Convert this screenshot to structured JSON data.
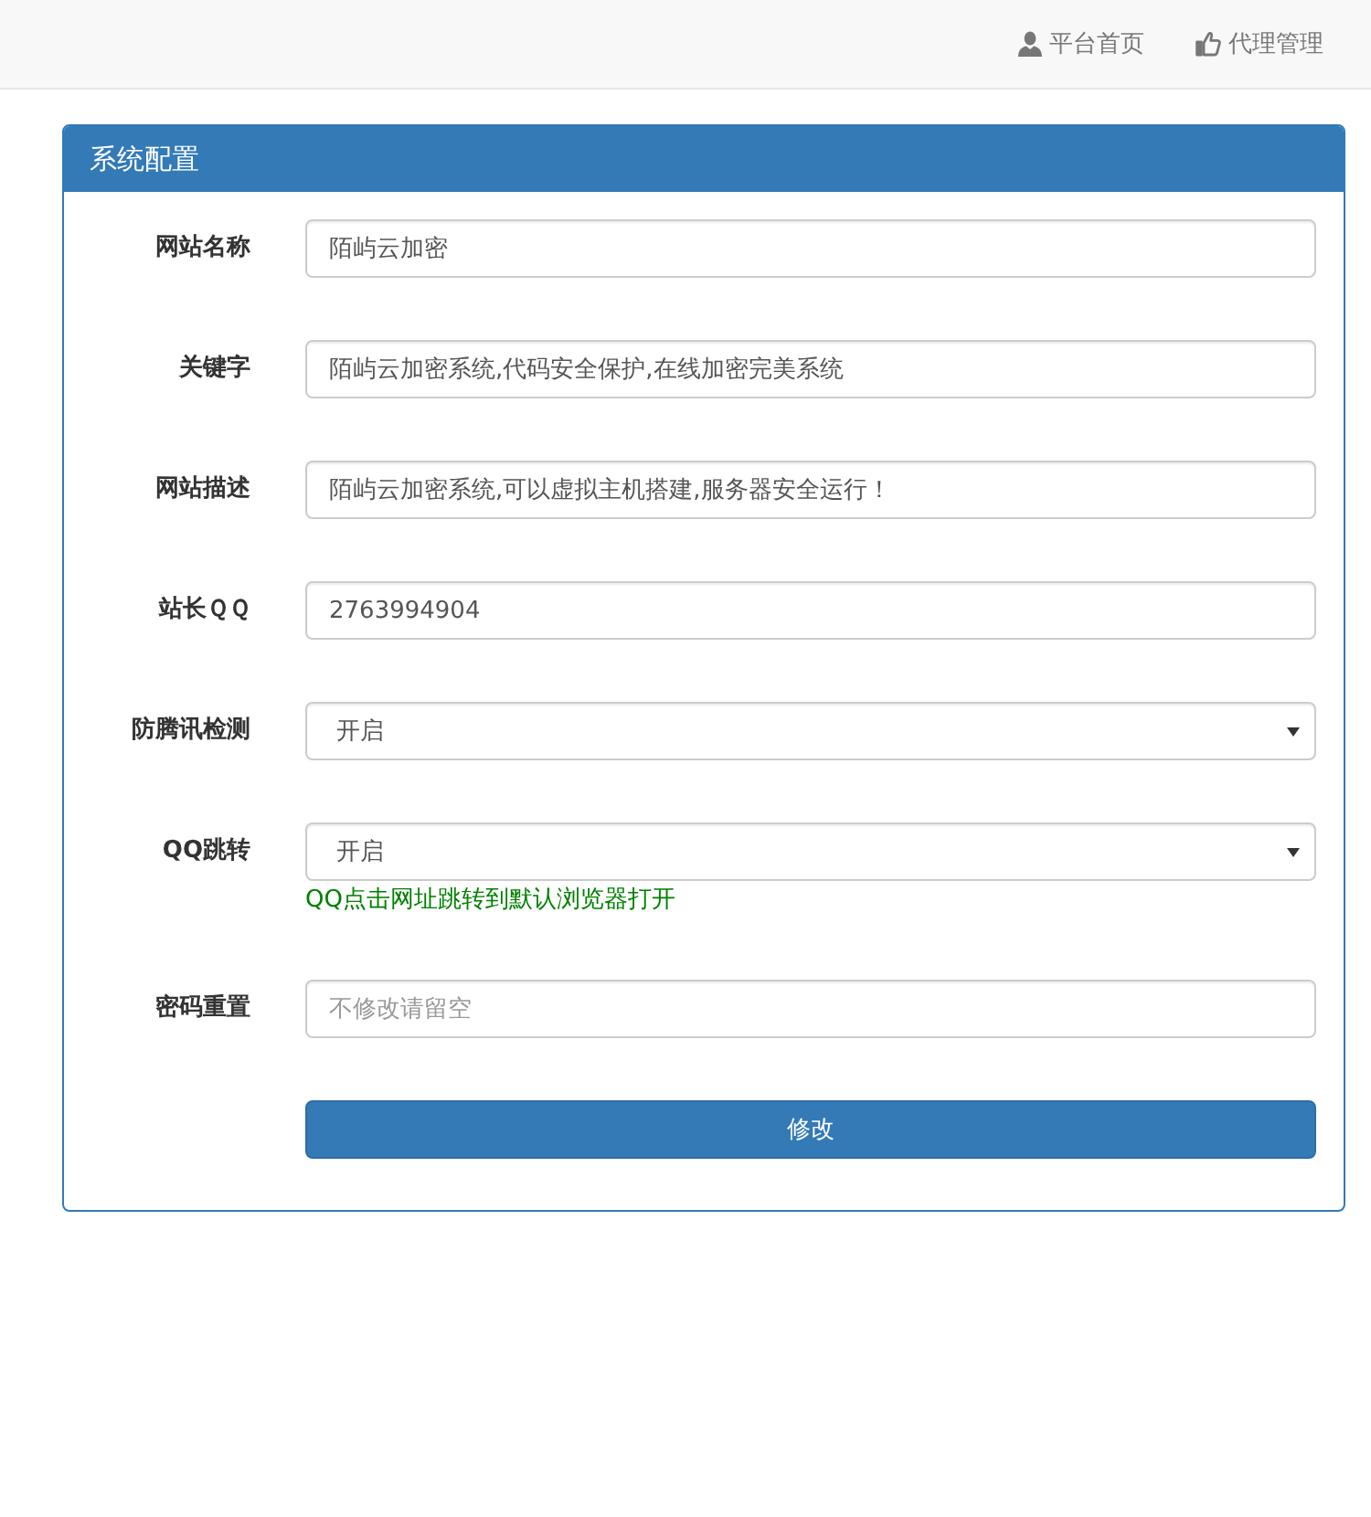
{
  "navbar": {
    "links": [
      {
        "label": "平台首页"
      },
      {
        "label": "代理管理"
      }
    ]
  },
  "panel": {
    "title": "系统配置",
    "fields": [
      {
        "kind": "text",
        "label": "网站名称",
        "value": "陌屿云加密"
      },
      {
        "kind": "text",
        "label": "关键字",
        "value": "陌屿云加密系统,代码安全保护,在线加密完美系统"
      },
      {
        "kind": "text",
        "label": "网站描述",
        "value": "陌屿云加密系统,可以虚拟主机搭建,服务器安全运行！"
      },
      {
        "kind": "text",
        "label": "站长ＱＱ",
        "value": "2763994904"
      },
      {
        "kind": "select",
        "label": "防腾讯检测",
        "value": "开启"
      },
      {
        "kind": "select",
        "label": "QQ跳转",
        "value": "开启",
        "help": "QQ点击网址跳转到默认浏览器打开"
      },
      {
        "kind": "text",
        "label": "密码重置",
        "placeholder": "不修改请留空"
      }
    ],
    "submit": "修改"
  }
}
